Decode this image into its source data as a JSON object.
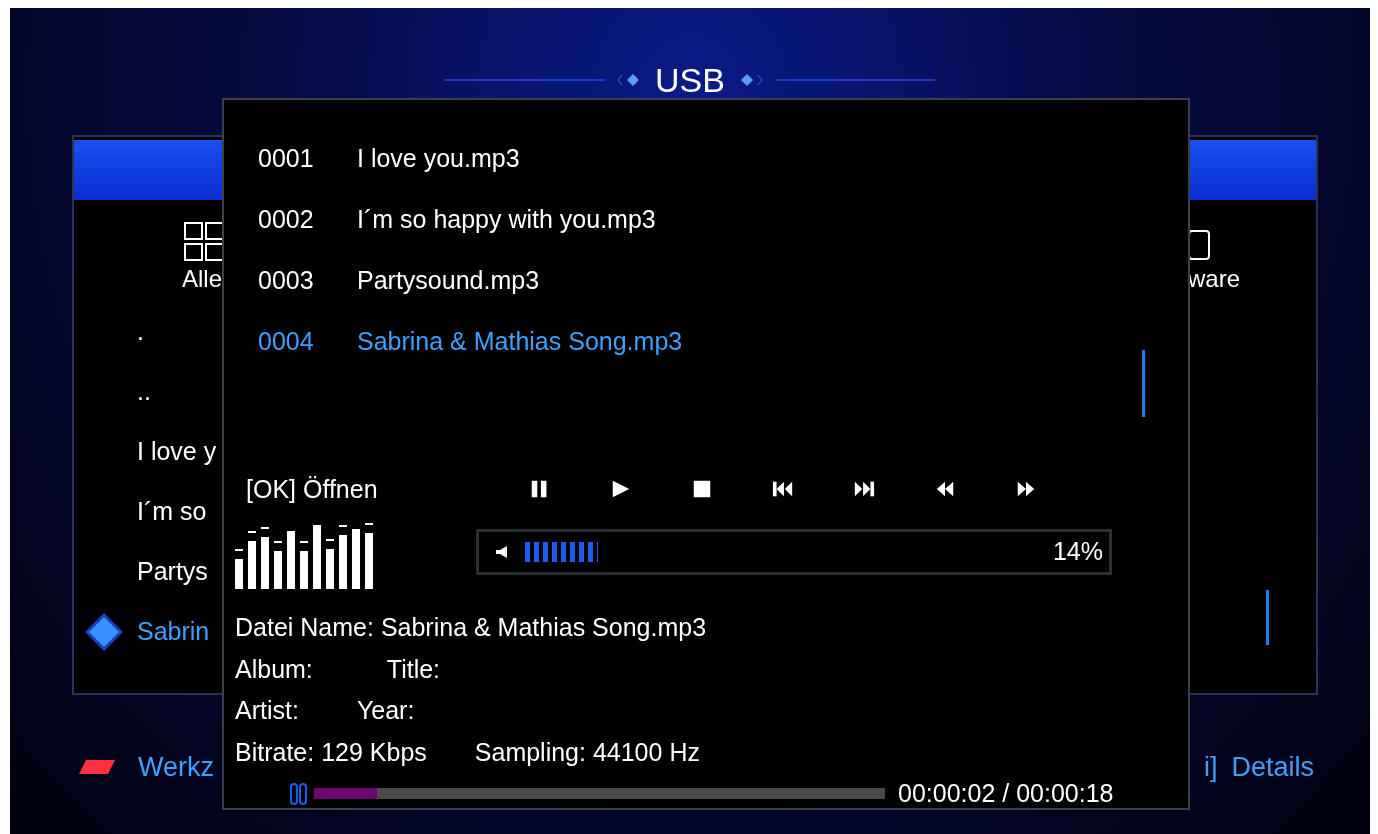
{
  "title": "USB",
  "background": {
    "categories": [
      "Alle",
      "ware"
    ],
    "files": [
      {
        "name": ".",
        "selected": false
      },
      {
        "name": "..",
        "selected": false
      },
      {
        "name": "I love y",
        "selected": false
      },
      {
        "name": "I´m so",
        "selected": false
      },
      {
        "name": "Partys",
        "selected": false
      },
      {
        "name": "Sabrin",
        "selected": true
      }
    ],
    "footer": [
      {
        "label": "Werkz"
      },
      {
        "key": "i]",
        "label": "Details"
      }
    ]
  },
  "player": {
    "playlist": [
      {
        "number": "0001",
        "name": "I love you.mp3",
        "selected": false
      },
      {
        "number": "0002",
        "name": "I´m so happy with you.mp3",
        "selected": false
      },
      {
        "number": "0003",
        "name": "Partysound.mp3",
        "selected": false
      },
      {
        "number": "0004",
        "name": "Sabrina & Mathias Song.mp3",
        "selected": true
      }
    ],
    "hint": "[OK] Öffnen",
    "volume": {
      "level": 0.14,
      "reading": "14%"
    },
    "info": [
      [
        "Datei Name: Sabrina & Mathias Song.mp3"
      ],
      [
        "Album:",
        "Title:"
      ],
      [
        "Artist:",
        "Year:"
      ],
      [
        "Bitrate: 129 Kbps",
        "Sampling: 44100 Hz"
      ]
    ],
    "progress": {
      "level": 0.11,
      "time": "00:00:02 / 00:00:18"
    }
  }
}
